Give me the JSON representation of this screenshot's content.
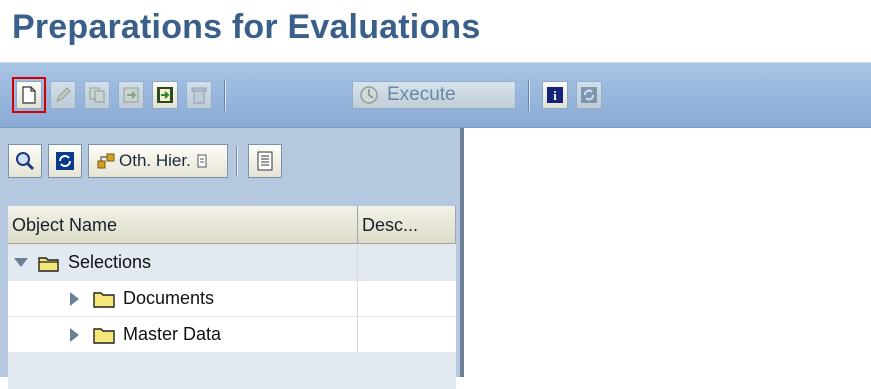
{
  "page": {
    "title": "Preparations for Evaluations"
  },
  "toolbar": {
    "execute_label": "Execute"
  },
  "hierarchy_toolbar": {
    "other_hierarchy_label": "Oth. Hier."
  },
  "tree": {
    "columns": [
      "Object Name",
      "Desc..."
    ],
    "rows": [
      {
        "label": "Selections",
        "expanded": true
      },
      {
        "label": "Documents",
        "expanded": false
      },
      {
        "label": "Master Data",
        "expanded": false
      }
    ]
  },
  "colors": {
    "title": "#3a5f8b",
    "toolbar": "#98b6dc",
    "panel": "#b6c8df",
    "selection_outline": "#d40000"
  },
  "icons": [
    "new-document-icon",
    "edit-icon",
    "copy-icon",
    "move-icon",
    "transfer-icon",
    "delete-icon",
    "execute-icon",
    "info-icon",
    "refresh-icon",
    "find-icon",
    "refresh-tree-icon",
    "other-hierarchy-icon",
    "dropdown-icon",
    "details-icon",
    "folder-open-icon",
    "folder-icon",
    "collapse-icon",
    "expand-icon"
  ]
}
